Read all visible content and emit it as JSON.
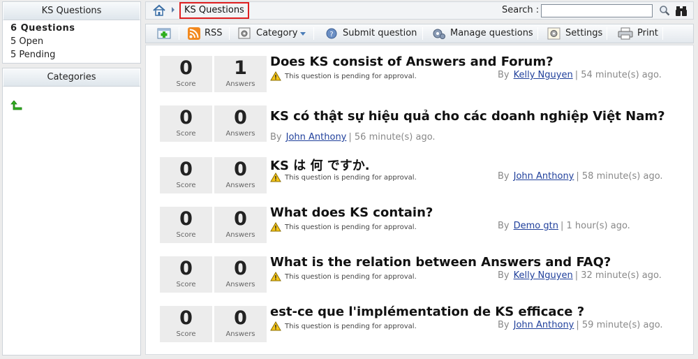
{
  "sidebar": {
    "ks_header": "KS Questions",
    "stats": [
      "6 Questions",
      "5 Open",
      "5 Pending"
    ],
    "categories_header": "Categories"
  },
  "breadcrumb": {
    "current": "KS Questions"
  },
  "search": {
    "label": "Search :",
    "value": ""
  },
  "toolbar": {
    "rss": "RSS",
    "category": "Category",
    "submit": "Submit question",
    "manage": "Manage questions",
    "settings": "Settings",
    "print": "Print"
  },
  "labels": {
    "score": "Score",
    "answers": "Answers",
    "by": "By",
    "pending": "This question is pending for approval."
  },
  "questions": [
    {
      "score": "0",
      "answers": "1",
      "title": "Does KS consist of Answers and Forum?",
      "pending": true,
      "author": "Kelly Nguyen",
      "time": "| 54 minute(s) ago."
    },
    {
      "score": "0",
      "answers": "0",
      "title": "KS có thật sự hiệu quả cho các doanh nghiệp Việt Nam?",
      "pending": false,
      "author": "John Anthony",
      "time": "| 56 minute(s) ago."
    },
    {
      "score": "0",
      "answers": "0",
      "title": "KS は 何 ですか.",
      "pending": true,
      "author": "John Anthony",
      "time": "| 58 minute(s) ago."
    },
    {
      "score": "0",
      "answers": "0",
      "title": "What does KS contain?",
      "pending": true,
      "author": "Demo gtn",
      "time": "| 1 hour(s) ago."
    },
    {
      "score": "0",
      "answers": "0",
      "title": "What is the relation between Answers and FAQ?",
      "pending": true,
      "author": "Kelly Nguyen",
      "time": "| 32 minute(s) ago."
    },
    {
      "score": "0",
      "answers": "0",
      "title": "est-ce que l'implémentation de KS efficace ?",
      "pending": true,
      "author": "John Anthony",
      "time": "| 59 minute(s) ago."
    }
  ],
  "colors": {
    "link": "#1f3f9b",
    "highlight_border": "#e02020",
    "box_bg": "#ececec"
  }
}
